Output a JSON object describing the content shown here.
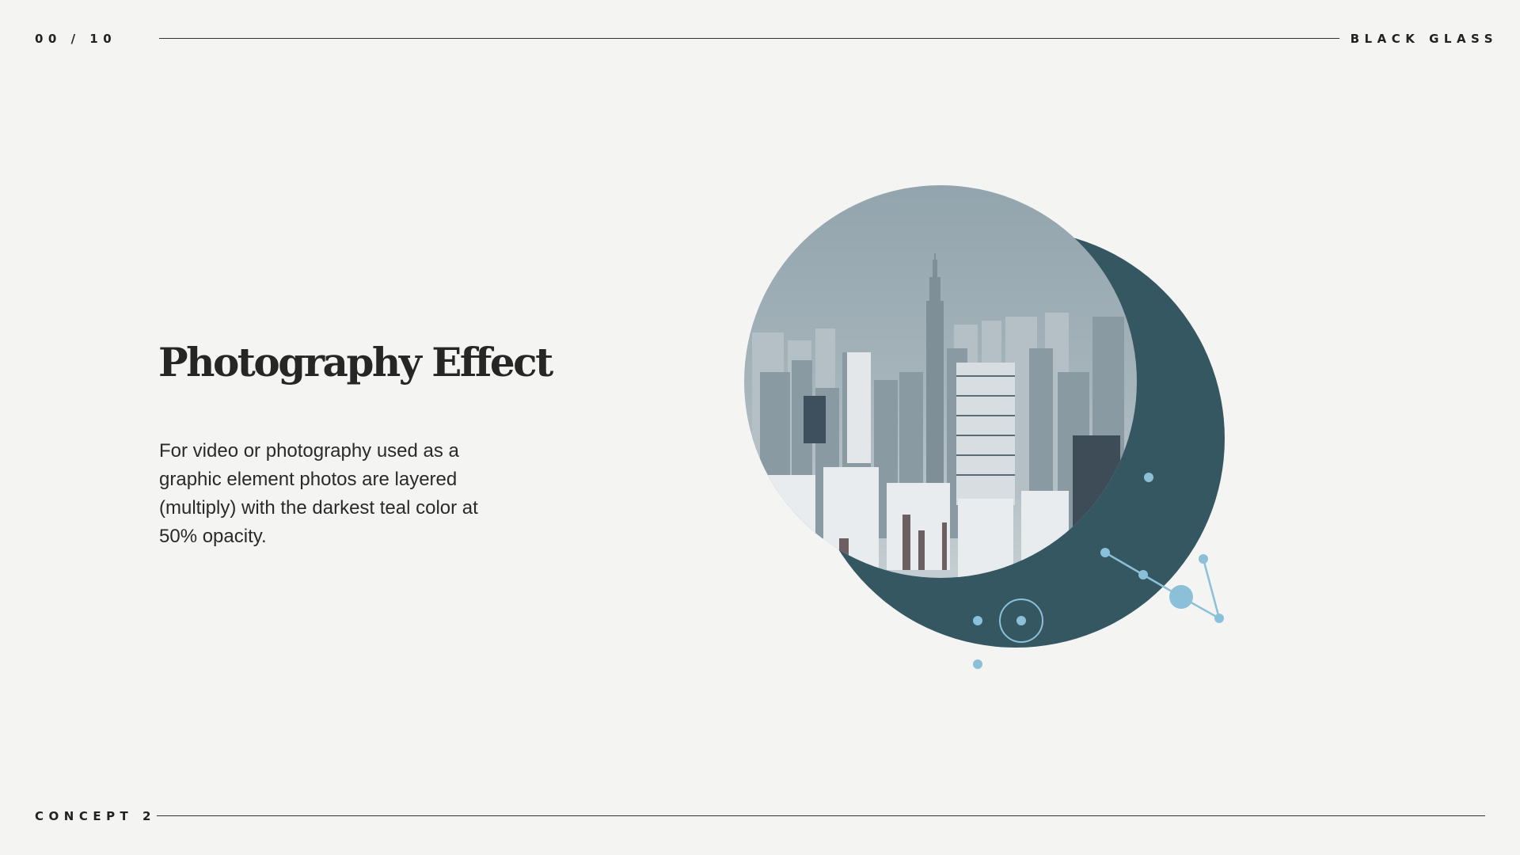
{
  "header": {
    "page_number": "00 / 10",
    "brand": "BLACK GLASS"
  },
  "footer": {
    "concept": "CONCEPT 2"
  },
  "main": {
    "title": "Photography Effect",
    "body": "For video or photography used as a graphic element photos are layered (multiply) with the darkest teal color at 50% opacity."
  },
  "colors": {
    "background": "#f4f4f2",
    "dark_teal": "#345762",
    "accent_blue": "#8cc0d8",
    "photo_overlay": "#95a8b0"
  },
  "graphic": {
    "photo": "city skyline photo layered with teal overlay",
    "decoration": "constellation-dots"
  }
}
